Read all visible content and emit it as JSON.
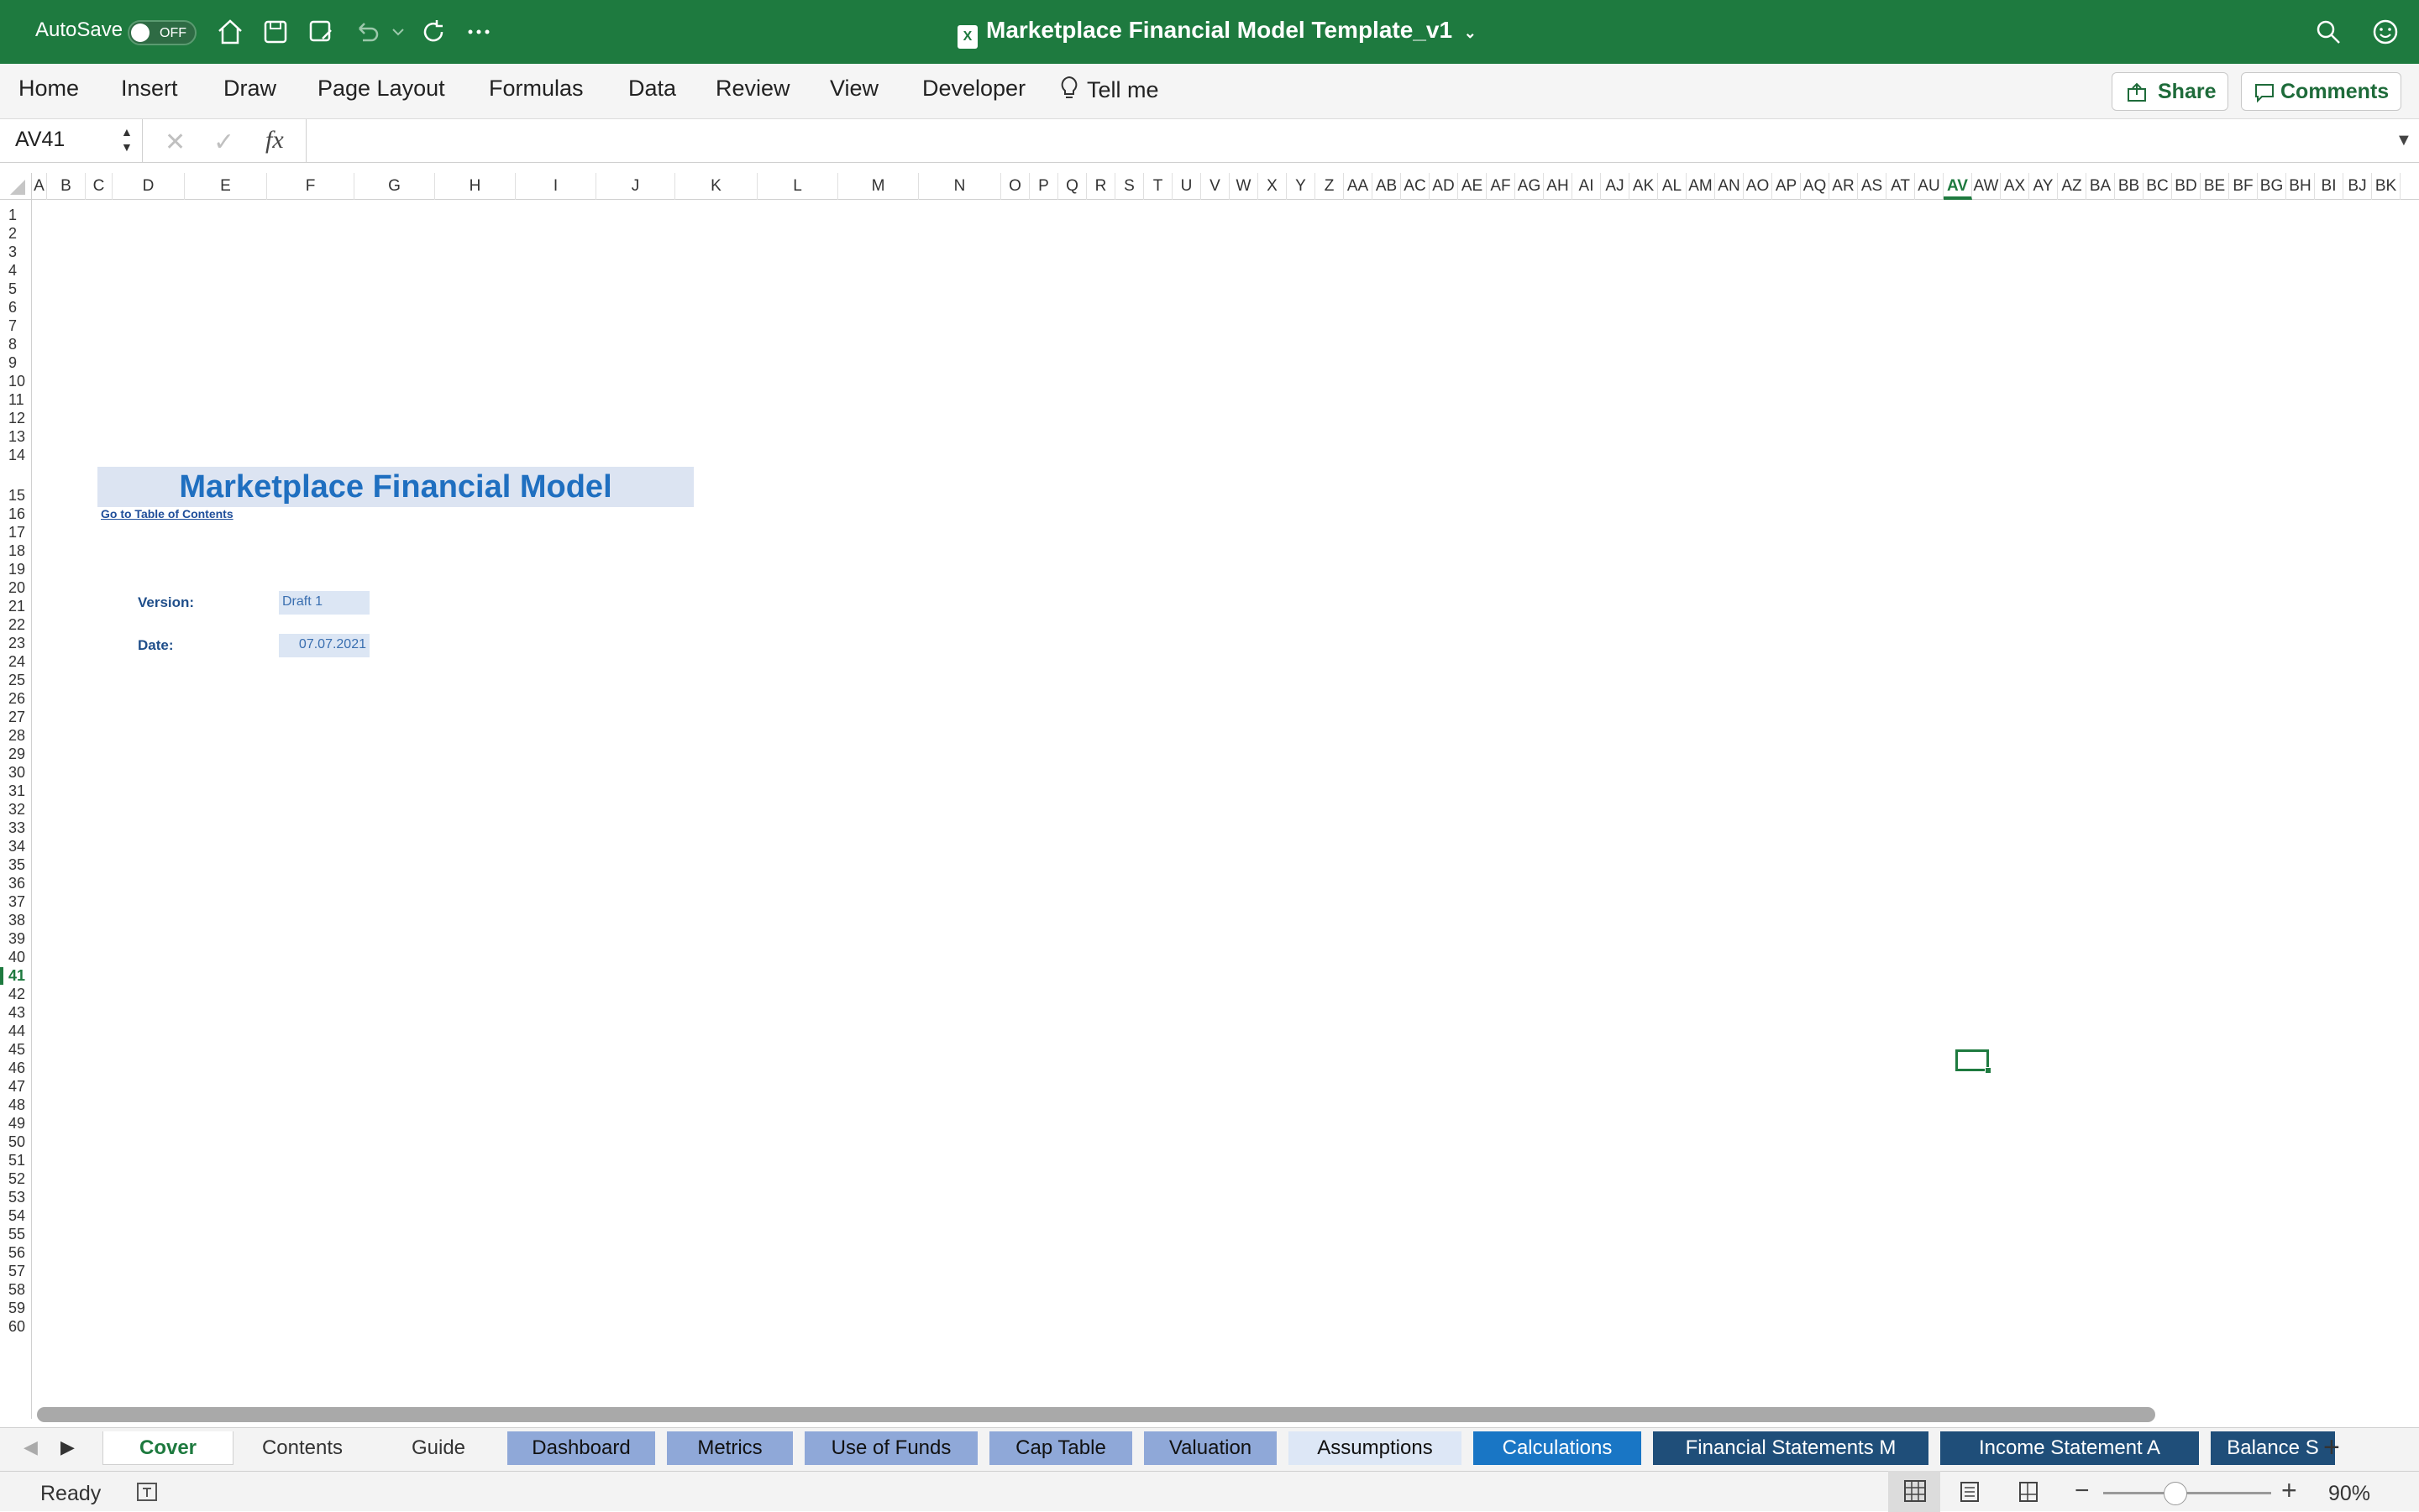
{
  "app": {
    "autosave_label": "AutoSave",
    "autosave_state": "OFF",
    "doc_title": "Marketplace Financial Model Template_v1"
  },
  "ribbon": {
    "tabs": [
      "Home",
      "Insert",
      "Draw",
      "Page Layout",
      "Formulas",
      "Data",
      "Review",
      "View",
      "Developer",
      "Tell me"
    ],
    "share_label": "Share",
    "comments_label": "Comments"
  },
  "formula_bar": {
    "name_box": "AV41",
    "fx_label": "fx",
    "content": ""
  },
  "columns": [
    "A",
    "B",
    "C",
    "D",
    "E",
    "F",
    "G",
    "H",
    "I",
    "J",
    "K",
    "L",
    "M",
    "N",
    "O",
    "P",
    "Q",
    "R",
    "S",
    "T",
    "U",
    "V",
    "W",
    "X",
    "Y",
    "Z",
    "AA",
    "AB",
    "AC",
    "AD",
    "AE",
    "AF",
    "AG",
    "AH",
    "AI",
    "AJ",
    "AK",
    "AL",
    "AM",
    "AN",
    "AO",
    "AP",
    "AQ",
    "AR",
    "AS",
    "AT",
    "AU",
    "AV",
    "AW",
    "AX",
    "AY",
    "AZ",
    "BA",
    "BB",
    "BC",
    "BD",
    "BE",
    "BF",
    "BG",
    "BH",
    "BI",
    "BJ",
    "BK"
  ],
  "selected_column": "AV",
  "selected_row": "41",
  "rows_visible": 60,
  "sheet": {
    "title": "Marketplace Financial Model",
    "toc_link": "Go to Table of Contents",
    "version_label": "Version:",
    "version_value": "Draft 1",
    "date_label": "Date:",
    "date_value": "07.07.2021"
  },
  "tabs": [
    {
      "label": "Cover",
      "style": "active"
    },
    {
      "label": "Contents",
      "style": "plain"
    },
    {
      "label": "Guide",
      "style": "plain"
    },
    {
      "label": "Dashboard",
      "style": "blue"
    },
    {
      "label": "Metrics",
      "style": "blue"
    },
    {
      "label": "Use of Funds",
      "style": "blue"
    },
    {
      "label": "Cap Table",
      "style": "blue"
    },
    {
      "label": "Valuation",
      "style": "blue"
    },
    {
      "label": "Assumptions",
      "style": "light"
    },
    {
      "label": "Calculations",
      "style": "mid"
    },
    {
      "label": "Financial Statements M",
      "style": "dark"
    },
    {
      "label": "Income Statement A",
      "style": "dark"
    },
    {
      "label": "Balance S",
      "style": "dark"
    }
  ],
  "status": {
    "state": "Ready",
    "zoom": "90%"
  },
  "colors": {
    "titlebar": "#1e7a3f",
    "accent": "#1e7a3f",
    "title_text": "#1f6fc0"
  }
}
